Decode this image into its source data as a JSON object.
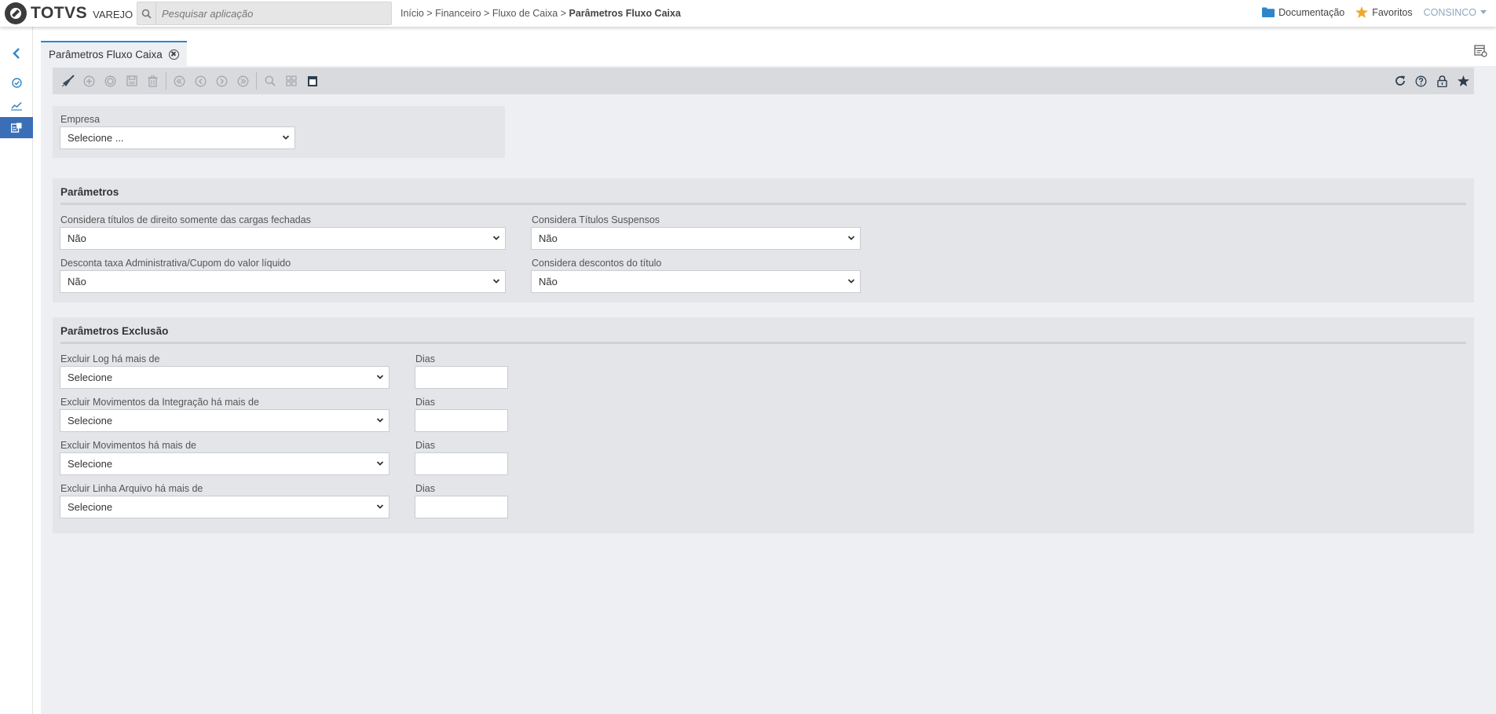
{
  "app": {
    "brand": "TOTVS",
    "brand_sub": "VAREJO"
  },
  "search": {
    "placeholder": "Pesquisar aplicação"
  },
  "breadcrumb": {
    "items": [
      "Início",
      "Financeiro",
      "Fluxo de Caixa"
    ],
    "separator": ">",
    "current": "Parâmetros Fluxo Caixa"
  },
  "header_right": {
    "documentation": "Documentação",
    "favorites": "Favoritos",
    "user": "CONSINCO"
  },
  "tab": {
    "label": "Parâmetros Fluxo Caixa"
  },
  "toolbar": {
    "left_icons": [
      "broom-icon",
      "add-icon",
      "cancel-icon",
      "save-icon",
      "delete-icon",
      "first-icon",
      "previous-icon",
      "next-icon",
      "last-icon",
      "search-icon",
      "grid-icon",
      "report-icon"
    ],
    "right_icons": [
      "refresh-icon",
      "help-icon",
      "lock-icon",
      "star-icon"
    ]
  },
  "empresa": {
    "label": "Empresa",
    "value": "Selecione ..."
  },
  "parametros": {
    "title": "Parâmetros",
    "fields": [
      {
        "label": "Considera títulos de direito somente das cargas fechadas",
        "value": "Não"
      },
      {
        "label": "Considera Títulos Suspensos",
        "value": "Não"
      },
      {
        "label": "Desconta taxa Administrativa/Cupom do valor líquido",
        "value": "Não"
      },
      {
        "label": "Considera descontos do título",
        "value": "Não"
      }
    ]
  },
  "exclusao": {
    "title": "Parâmetros Exclusão",
    "days_label": "Dias",
    "rows": [
      {
        "label": "Excluir Log há mais de",
        "value": "Selecione",
        "days": ""
      },
      {
        "label": "Excluir Movimentos da Integração há mais de",
        "value": "Selecione",
        "days": ""
      },
      {
        "label": "Excluir Movimentos há mais de",
        "value": "Selecione",
        "days": ""
      },
      {
        "label": "Excluir Linha Arquivo há mais de",
        "value": "Selecione",
        "days": ""
      }
    ]
  },
  "colors": {
    "accent": "#2e86c9",
    "rail_active": "#3a6fb7",
    "star": "#f0a830",
    "user": "#8fa8bf"
  }
}
